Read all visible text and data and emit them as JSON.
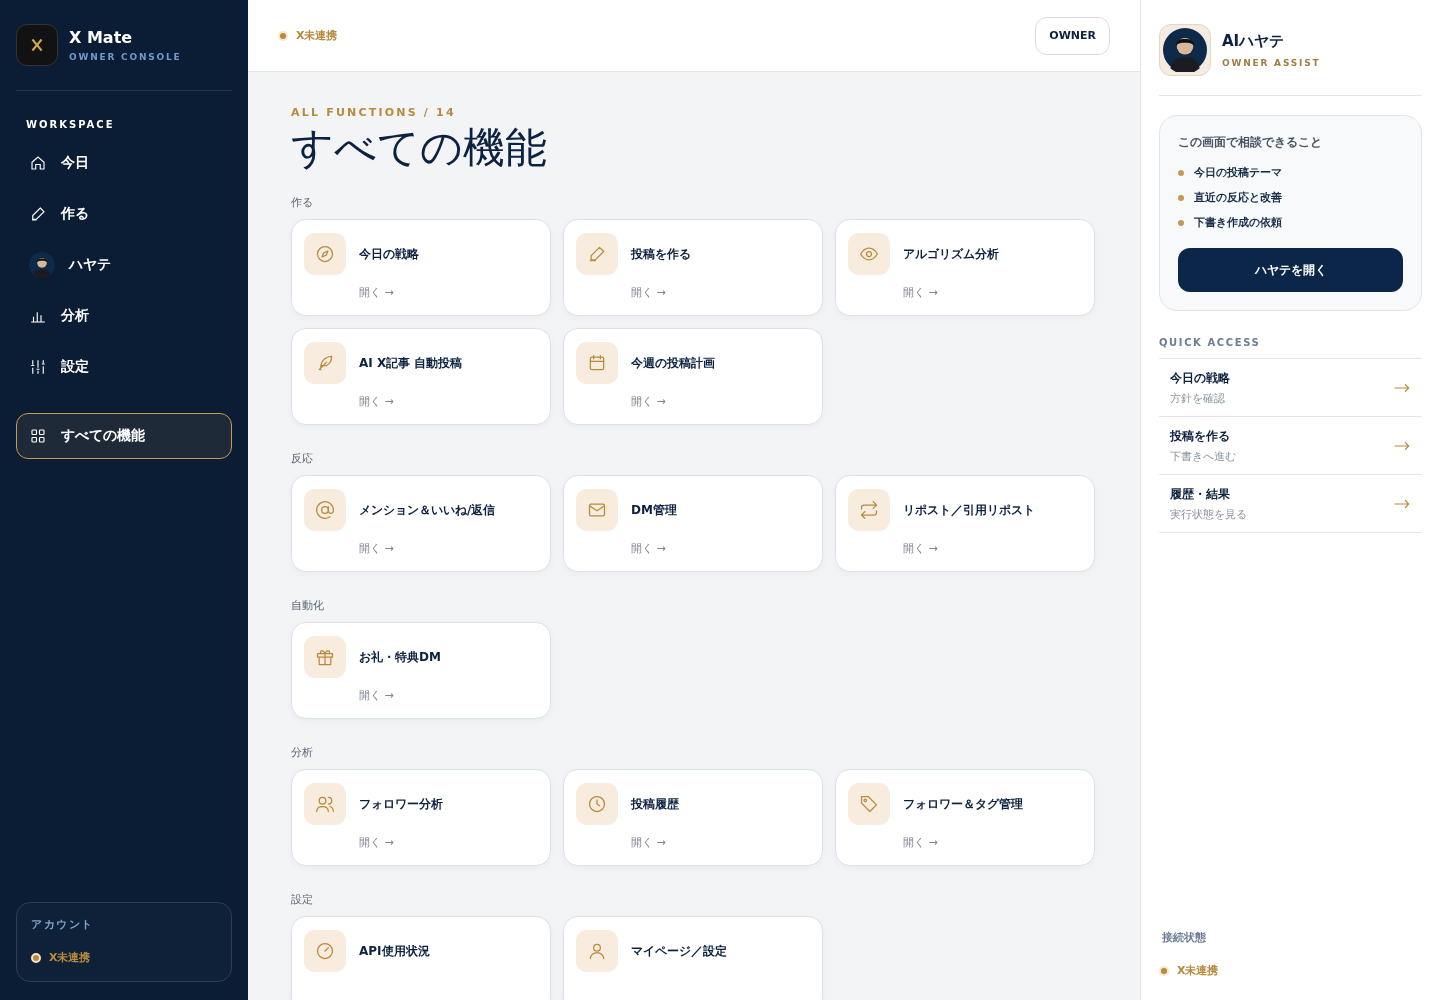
{
  "brand": {
    "name": "X Mate",
    "subtitle": "OWNER CONSOLE"
  },
  "sidebar": {
    "heading": "WORKSPACE",
    "items": [
      {
        "label": "今日",
        "selected": false
      },
      {
        "label": "作る",
        "selected": false
      },
      {
        "label": "ハヤテ",
        "selected": false
      },
      {
        "label": "分析",
        "selected": false
      },
      {
        "label": "設定",
        "selected": false
      },
      {
        "label": "すべての機能",
        "selected": true
      }
    ],
    "account": {
      "heading": "アカウント",
      "status": "X未連携"
    }
  },
  "topbar": {
    "status": "X未連携",
    "role_button": "OWNER"
  },
  "page": {
    "eyebrow": "ALL FUNCTIONS / 14",
    "title": "すべての機能",
    "sections": [
      {
        "label": "作る",
        "cards": [
          {
            "title": "今日の戦略",
            "action": "開く →"
          },
          {
            "title": "投稿を作る",
            "action": "開く →"
          },
          {
            "title": "アルゴリズム分析",
            "action": "開く →"
          },
          {
            "title": "AI X記事 自動投稿",
            "action": "開く →"
          },
          {
            "title": "今週の投稿計画",
            "action": "開く →"
          }
        ]
      },
      {
        "label": "反応",
        "cards": [
          {
            "title": "メンション＆いいね/返信",
            "action": "開く →"
          },
          {
            "title": "DM管理",
            "action": "開く →"
          },
          {
            "title": "リポスト／引用リポスト",
            "action": "開く →"
          }
        ]
      },
      {
        "label": "自動化",
        "cards": [
          {
            "title": "お礼・特典DM",
            "action": "開く →"
          }
        ]
      },
      {
        "label": "分析",
        "cards": [
          {
            "title": "フォロワー分析",
            "action": "開く →"
          },
          {
            "title": "投稿履歴",
            "action": "開く →"
          },
          {
            "title": "フォロワー＆タグ管理",
            "action": "開く →"
          }
        ]
      },
      {
        "label": "設定",
        "cards": [
          {
            "title": "API使用状況"
          },
          {
            "title": "マイページ／設定"
          }
        ]
      }
    ]
  },
  "assistant": {
    "name": "AIハヤテ",
    "subtitle": "OWNER ASSIST",
    "consult": {
      "heading": "この画面で相談できること",
      "items": [
        "今日の投稿テーマ",
        "直近の反応と改善",
        "下書き作成の依頼"
      ],
      "button": "ハヤテを開く"
    },
    "quick_access": {
      "heading": "QUICK ACCESS",
      "items": [
        {
          "title": "今日の戦略",
          "subtitle": "方針を確認"
        },
        {
          "title": "投稿を作る",
          "subtitle": "下書きへ進む"
        },
        {
          "title": "履歴・結果",
          "subtitle": "実行状態を見る"
        }
      ]
    },
    "connection": {
      "heading": "接続状態",
      "status": "X未連携"
    }
  }
}
